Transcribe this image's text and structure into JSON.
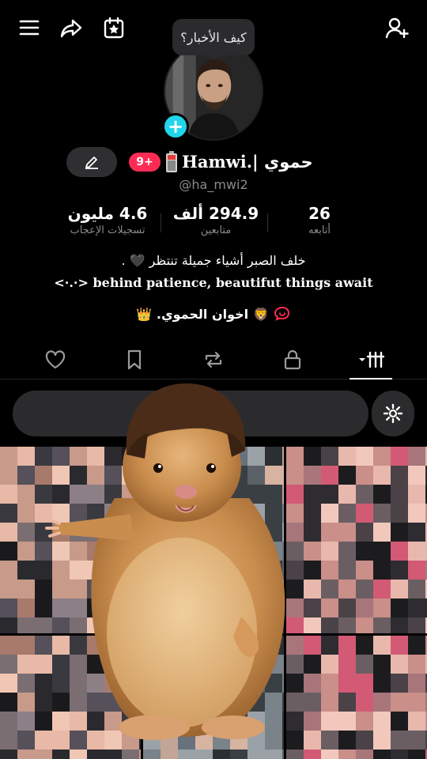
{
  "topbar": {
    "menu_icon": "hamburger-menu-icon",
    "share_icon": "share-arrow-icon",
    "calendar_icon": "calendar-star-icon",
    "add_friend_icon": "add-user-icon"
  },
  "bubble": {
    "text": "كيف الأخبار؟"
  },
  "profile": {
    "display_name_ar": "حموي | ",
    "display_name_en": "Hamwi.",
    "notif_count": "9+",
    "username": "@ha_mwi2"
  },
  "stats": {
    "following_num": "26",
    "following_label": "أتابعه",
    "followers_num": "294.9 ألف",
    "followers_label": "متابعين",
    "likes_num": "4.6 مليون",
    "likes_label": "تسجيلات الإعجاب"
  },
  "bio": {
    "line1": "خلف الصبر أشياء جميلة تنتظر 🖤 .",
    "line2": "<·.·> behind patience, beautifut things await",
    "group_name": "اخوان الحموي.",
    "group_emoji_left": "👑",
    "group_emoji_lion": "🦁"
  },
  "tabs": [
    "videos-grid-tab",
    "private-tab",
    "reposts-tab",
    "favorites-tab",
    "liked-tab"
  ],
  "search": {
    "text": ". 🤍"
  },
  "colors": {
    "accent_cyan": "#20d5ec",
    "accent_pink": "#fe2c55",
    "background": "#000000",
    "surface": "#2b2b2d"
  }
}
